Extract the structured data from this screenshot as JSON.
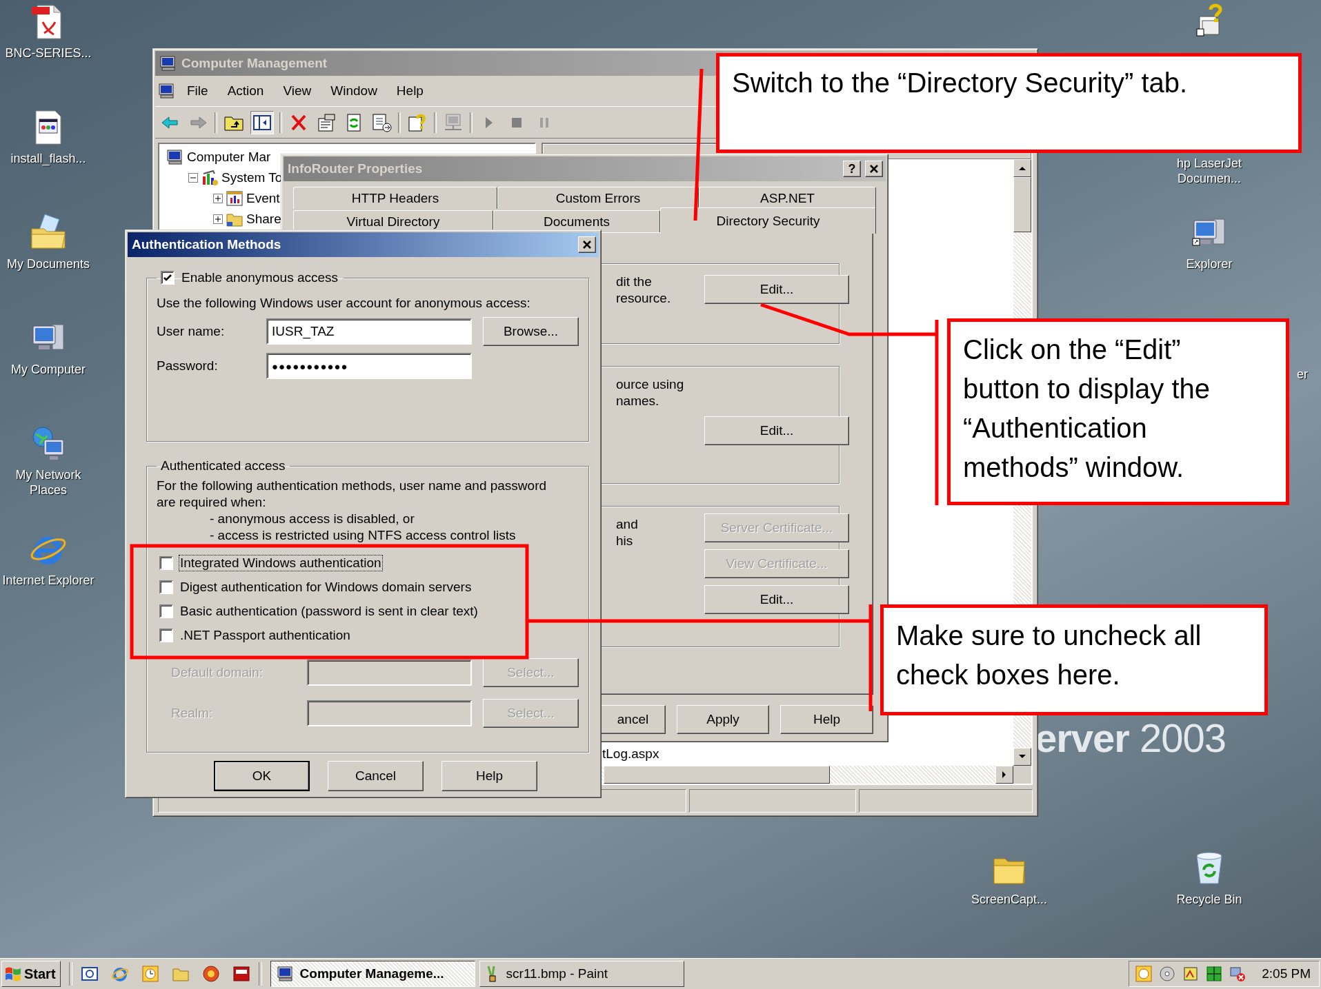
{
  "desktop": {
    "icons_left": [
      {
        "label": "BNC-SERIES...",
        "kind": "pdf"
      },
      {
        "label": "install_flash...",
        "kind": "html-file"
      },
      {
        "label": "My Documents",
        "kind": "documents-folder"
      },
      {
        "label": "My Computer",
        "kind": "computer"
      },
      {
        "label": "My Network Places",
        "kind": "network"
      },
      {
        "label": "Internet Explorer",
        "kind": "browser"
      }
    ],
    "icons_right": [
      {
        "kind": "help"
      },
      {
        "label": "hp LaserJet Documen...",
        "kind": "none"
      },
      {
        "label": "Explorer",
        "kind": "explorer"
      },
      {
        "label": "er",
        "kind": "none"
      },
      {
        "label": "ScreenCapt...",
        "kind": "folder"
      },
      {
        "label": "Recycle Bin",
        "kind": "recycle-bin"
      }
    ],
    "wallpaper_logo": "**erver** 2003"
  },
  "computer_management": {
    "title": "Computer Management",
    "menu": [
      "File",
      "Action",
      "View",
      "Window",
      "Help"
    ],
    "tree": [
      {
        "label": "Computer Mar",
        "kind": "computer",
        "children": [
          {
            "label": "System To",
            "kind": "tools",
            "expanded": true,
            "children": [
              {
                "label": "Event",
                "kind": "event-log",
                "expanded": false
              },
              {
                "label": "Share",
                "kind": "folder",
                "expanded": false
              }
            ]
          }
        ]
      }
    ],
    "list_item": "tLog.aspx"
  },
  "inforouter_properties": {
    "title": "InfoRouter Properties",
    "help_button": "?",
    "tabs_row_1": [
      {
        "label": "HTTP Headers",
        "selected": false
      },
      {
        "label": "Custom Errors",
        "selected": false
      },
      {
        "label": "ASP.NET",
        "selected": false
      }
    ],
    "tabs_row_2": [
      {
        "label": "Virtual Directory",
        "selected": false
      },
      {
        "label": "Documents",
        "selected": false
      },
      {
        "label": "Directory Security",
        "selected": true
      }
    ],
    "groups": [
      {
        "lines": [
          "dit the",
          "resource."
        ],
        "buttons": [
          {
            "label": "Edit...",
            "disabled": false
          }
        ]
      },
      {
        "lines": [
          "ource using",
          "names."
        ],
        "buttons": [
          {
            "label": "Edit...",
            "disabled": false
          }
        ]
      },
      {
        "lines": [
          "and",
          "his"
        ],
        "buttons": [
          {
            "label": "Server Certificate...",
            "disabled": true
          },
          {
            "label": "View Certificate...",
            "disabled": true
          },
          {
            "label": "Edit...",
            "disabled": false
          }
        ]
      }
    ],
    "buttons": [
      "ancel",
      "Apply",
      "Help"
    ]
  },
  "authentication_methods": {
    "title": "Authentication Methods",
    "anonymous_access": {
      "label": "Enable anonymous access",
      "checked": true,
      "note": "Use the following Windows user account for anonymous access:",
      "user_name_label": "User name:",
      "user_name": "IUSR_TAZ",
      "browse_button": "Browse...",
      "password_label": "Password:",
      "password": "●●●●●●●●●●●"
    },
    "authenticated_access": {
      "title": "Authenticated access",
      "description": "For the following authentication methods, user name and password are required when:",
      "conditions": [
        "- anonymous access is disabled, or",
        "- access is restricted using NTFS access control lists"
      ],
      "methods": [
        {
          "label": "Integrated Windows authentication",
          "checked": false,
          "focused": true
        },
        {
          "label": "Digest authentication for Windows domain servers",
          "checked": false,
          "focused": false
        },
        {
          "label": "Basic authentication (password is sent in clear text)",
          "checked": false,
          "focused": false
        },
        {
          "label": ".NET Passport authentication",
          "checked": false,
          "focused": false
        }
      ],
      "fields": [
        {
          "label": "Default domain:",
          "button": "Select...",
          "disabled": true
        },
        {
          "label": "Realm:",
          "button": "Select...",
          "disabled": true
        }
      ]
    },
    "buttons": [
      {
        "label": "OK",
        "default": true
      },
      {
        "label": "Cancel",
        "default": false
      },
      {
        "label": "Help",
        "default": false
      }
    ]
  },
  "callouts": [
    {
      "text": "Switch to the “Directory Security” tab."
    },
    {
      "text": "Click on the “Edit” button to display the “Authentication methods” window."
    },
    {
      "text": "Make sure to uncheck all check boxes here."
    }
  ],
  "taskbar": {
    "start": "Start",
    "tasks": [
      {
        "label": "Computer Manageme...",
        "selected": true
      },
      {
        "label": "scr11.bmp - Paint",
        "selected": false
      }
    ],
    "clock": "2:05 PM"
  }
}
